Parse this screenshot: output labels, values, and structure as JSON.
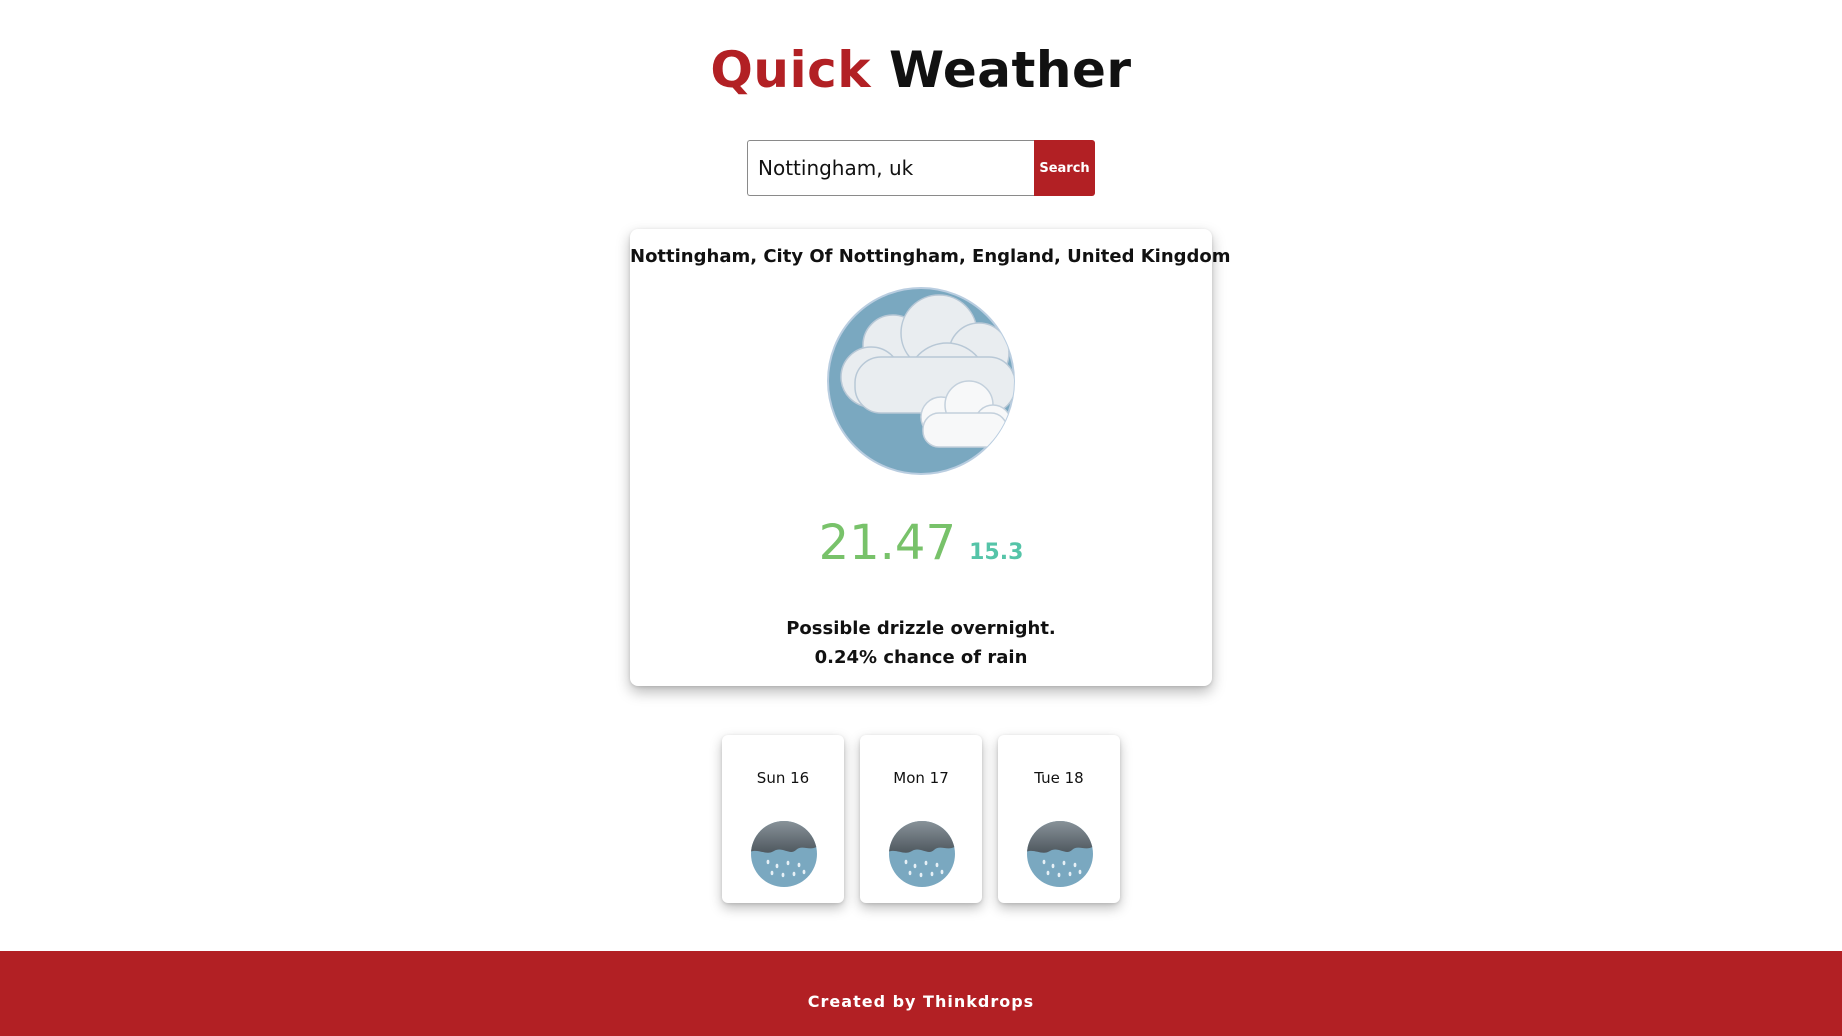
{
  "header": {
    "title_accent": "Quick",
    "title_rest": "Weather"
  },
  "search": {
    "value": "Nottingham, uk",
    "button_label": "Search"
  },
  "current": {
    "location": "Nottingham, City Of Nottingham, England, United Kingdom",
    "icon": "partly-cloudy-icon",
    "temperature": "21.47",
    "feels_like": "15.3",
    "summary": "Possible drizzle overnight.",
    "rain_chance": "0.24% chance of rain"
  },
  "forecast": {
    "days": [
      {
        "label": "Sun 16",
        "icon": "rain-icon"
      },
      {
        "label": "Mon 17",
        "icon": "rain-icon"
      },
      {
        "label": "Tue 18",
        "icon": "rain-icon"
      }
    ]
  },
  "footer": {
    "text": "Created by Thinkdrops"
  },
  "colors": {
    "accent": "#b22024",
    "temperature": "#78c26a",
    "feels_like": "#55c4a8",
    "sky": "#7aa8c0"
  }
}
